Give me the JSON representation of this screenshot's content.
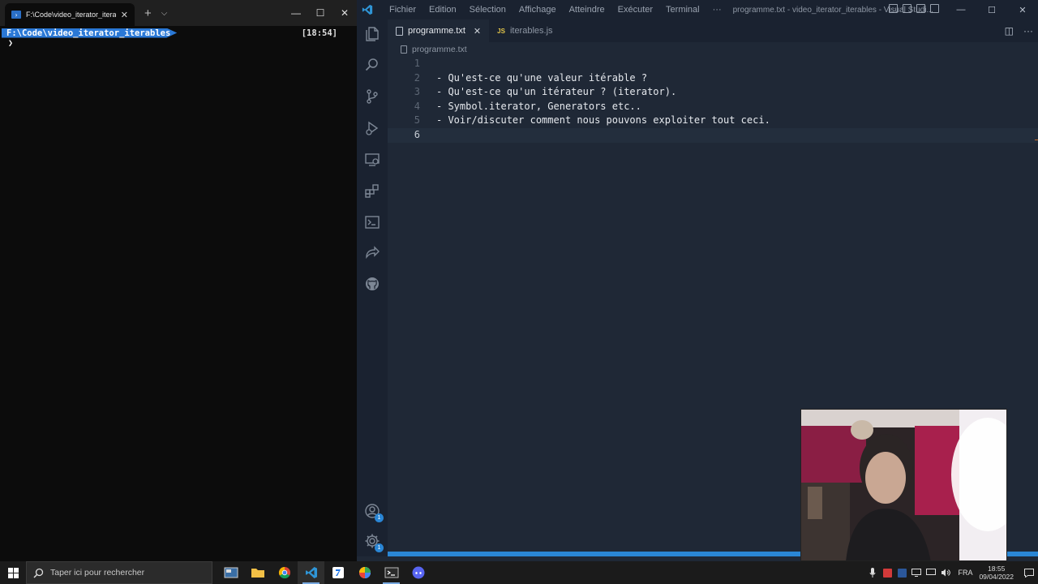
{
  "terminal": {
    "tab_title": "F:\\Code\\video_iterator_iterables",
    "tab_close": "✕",
    "new_tab": "+",
    "dropdown": "⌵",
    "prompt_path": "F:\\Code\\video_iterator_iterables",
    "prompt_time": "[18:54]",
    "prompt_caret": "❯",
    "controls": {
      "minimize": "—",
      "maximize": "☐",
      "close": "✕"
    }
  },
  "vscode": {
    "menu": [
      "Fichier",
      "Edition",
      "Sélection",
      "Affichage",
      "Atteindre",
      "Exécuter",
      "Terminal",
      "···"
    ],
    "window_title": "programme.txt - video_iterator_iterables - Visual Studi...",
    "controls": {
      "minimize": "—",
      "maximize": "☐",
      "close": "✕"
    },
    "tabs": [
      {
        "label": "programme.txt",
        "close": "✕",
        "active": true
      },
      {
        "label": "iterables.js",
        "icon_text": "JS",
        "active": false
      }
    ],
    "tab_actions": {
      "split": "◫",
      "more": "···"
    },
    "breadcrumb": "programme.txt",
    "lines": [
      {
        "n": "1",
        "text": ""
      },
      {
        "n": "2",
        "text": "- Qu'est-ce qu'une valeur itérable ?"
      },
      {
        "n": "3",
        "text": "- Qu'est-ce qu'un itérateur ? (iterator)."
      },
      {
        "n": "4",
        "text": "- Symbol.iterator, Generators etc.."
      },
      {
        "n": "5",
        "text": "- Voir/discuter comment nous pouvons exploiter tout ceci."
      },
      {
        "n": "6",
        "text": ""
      }
    ],
    "activity_icons": [
      "explorer-icon",
      "search-icon",
      "source-control-icon",
      "run-debug-icon",
      "remote-explorer-icon",
      "extensions-icon",
      "terminal-icon",
      "live-share-icon",
      "github-icon",
      "accounts-icon",
      "settings-gear-icon"
    ],
    "badges": {
      "accounts": "1",
      "settings": "1"
    },
    "colors": {
      "editor_bg": "#1f2836",
      "status_bar": "#2a86d5",
      "accent": "#2a86d5"
    }
  },
  "taskbar": {
    "search_placeholder": "Taper ici pour rechercher",
    "apps": [
      "task-view-icon",
      "file-explorer-icon",
      "chrome-icon",
      "vscode-icon",
      "app-blue-icon",
      "app-colorful-icon",
      "terminal-icon",
      "discord-icon"
    ],
    "language": "FRA",
    "time": "18:55",
    "date": "09/04/2022"
  }
}
